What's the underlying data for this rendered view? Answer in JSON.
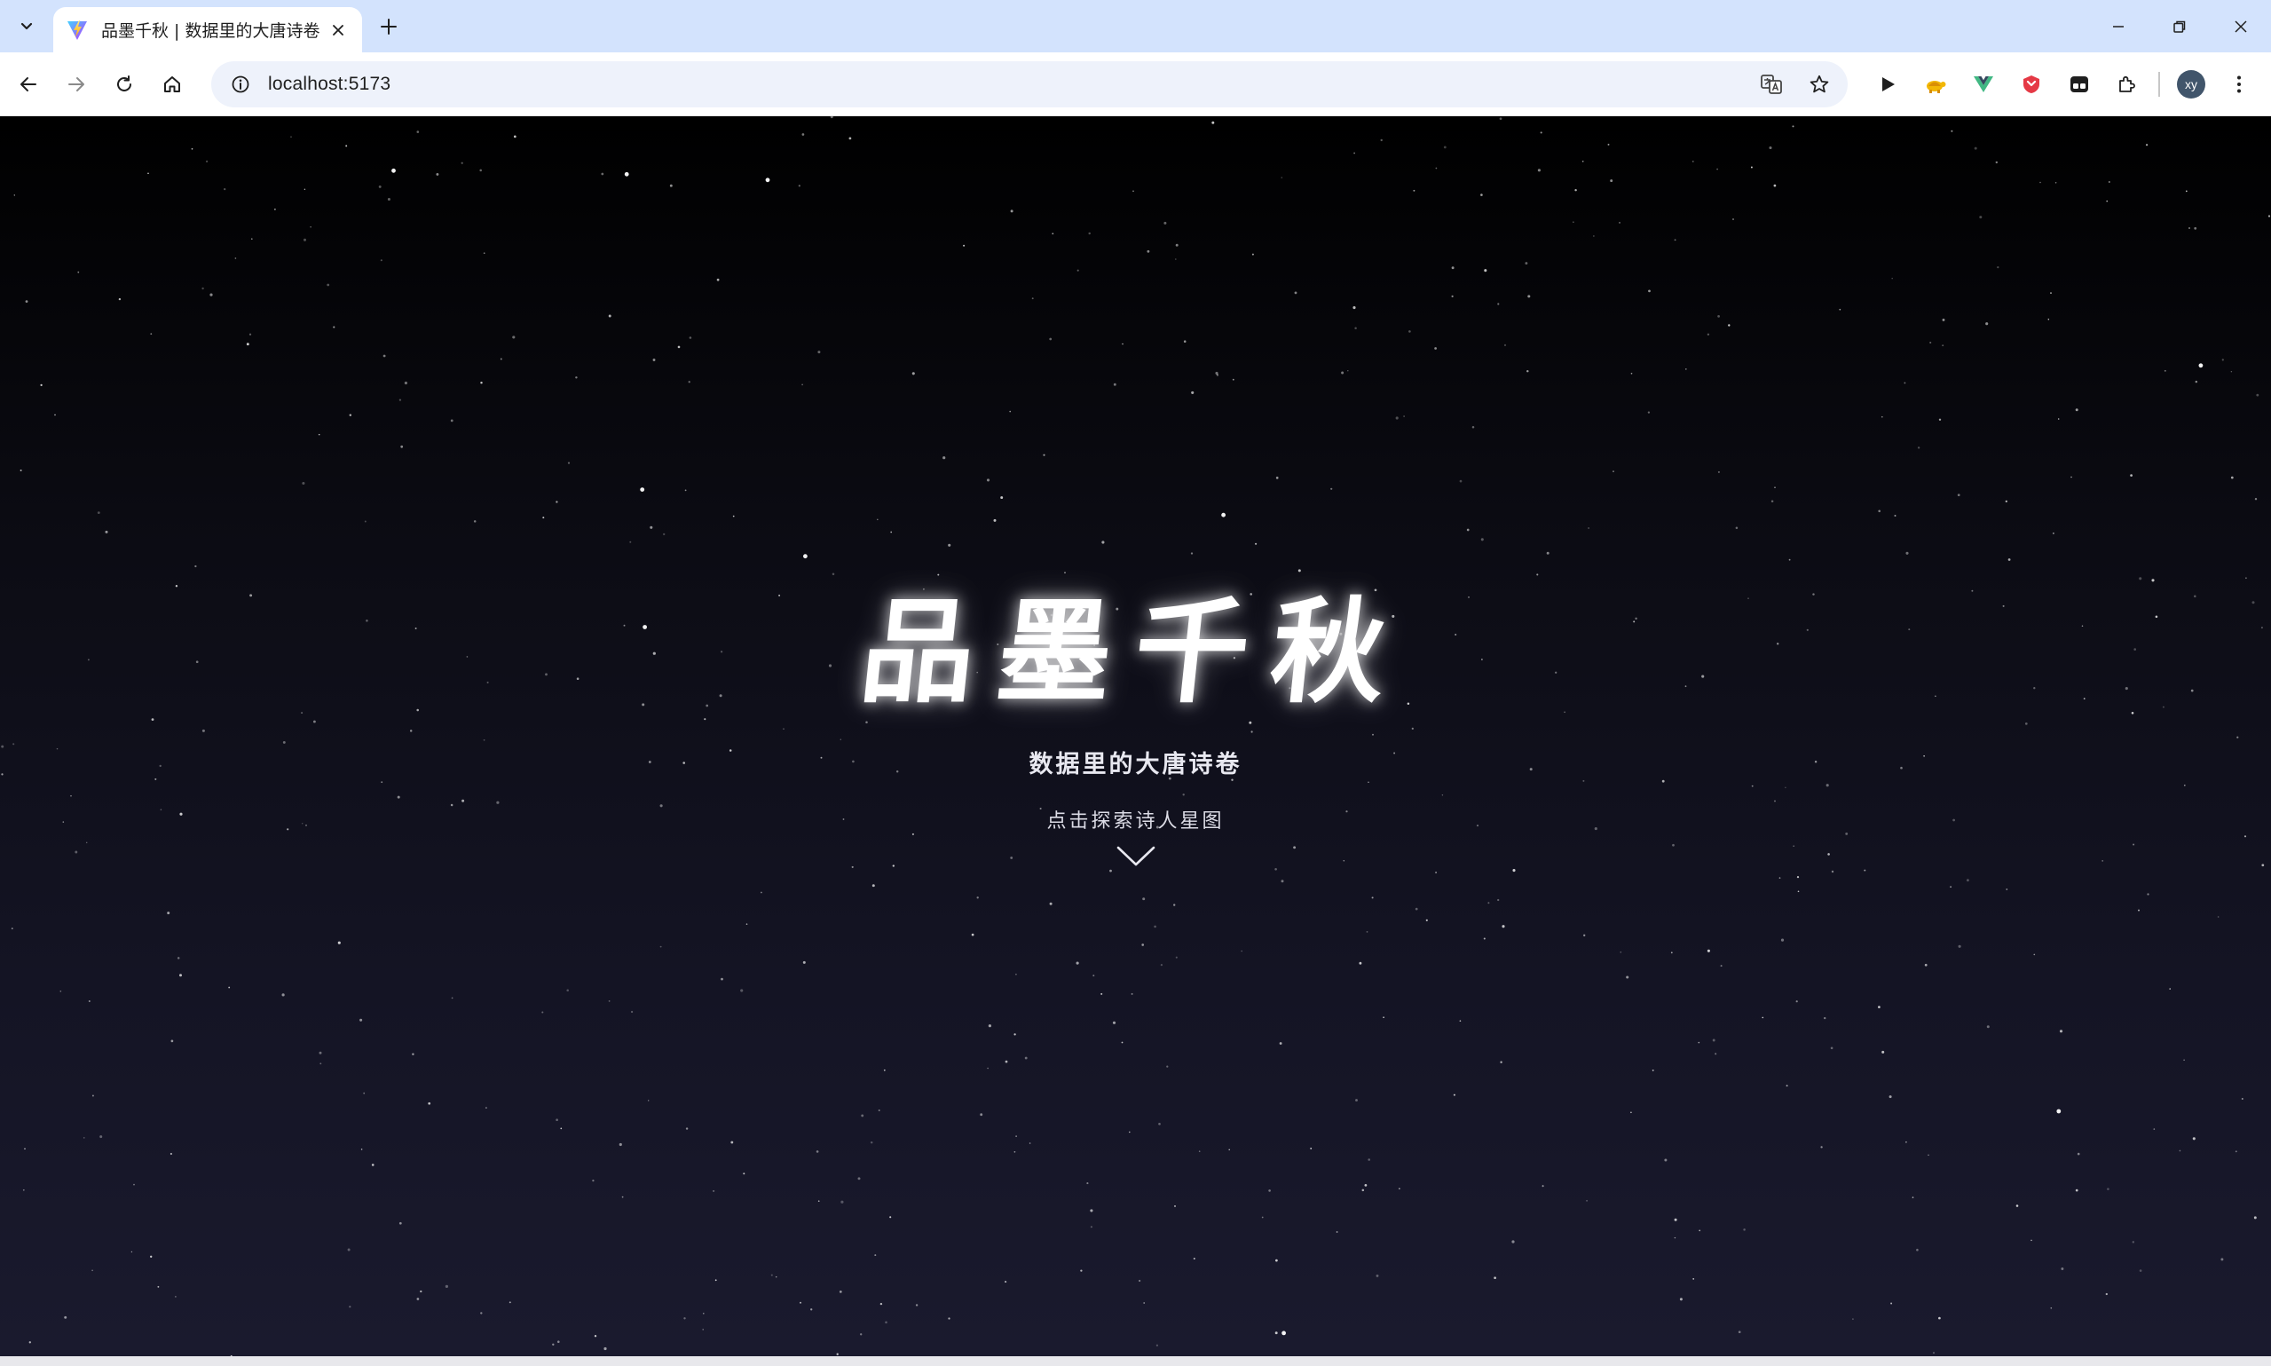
{
  "browser": {
    "tab": {
      "title": "品墨千秋 | 数据里的大唐诗卷",
      "favicon": "vite-logo-icon"
    },
    "new_tab_label": "+",
    "address": {
      "url": "localhost:5173"
    },
    "window_controls": [
      "minimize-icon",
      "restore-icon",
      "close-icon"
    ],
    "extensions": [
      "play-icon",
      "tortoise-extension-icon",
      "vue-devtools-icon",
      "shield-extension-icon",
      "media-extension-icon",
      "puzzle-icon"
    ],
    "profile": {
      "initials": "xy"
    }
  },
  "hero": {
    "title": "品墨千秋",
    "subtitle": "数据里的大唐诗卷",
    "cta_text": "点击探索诗人星图",
    "cta_icon": "chevron-down-icon"
  },
  "colors": {
    "tabstrip_bg": "#d3e3fd",
    "page_bg_top": "#000000",
    "page_bg_bottom": "#1a1a2e",
    "title_text": "#ffffff"
  }
}
